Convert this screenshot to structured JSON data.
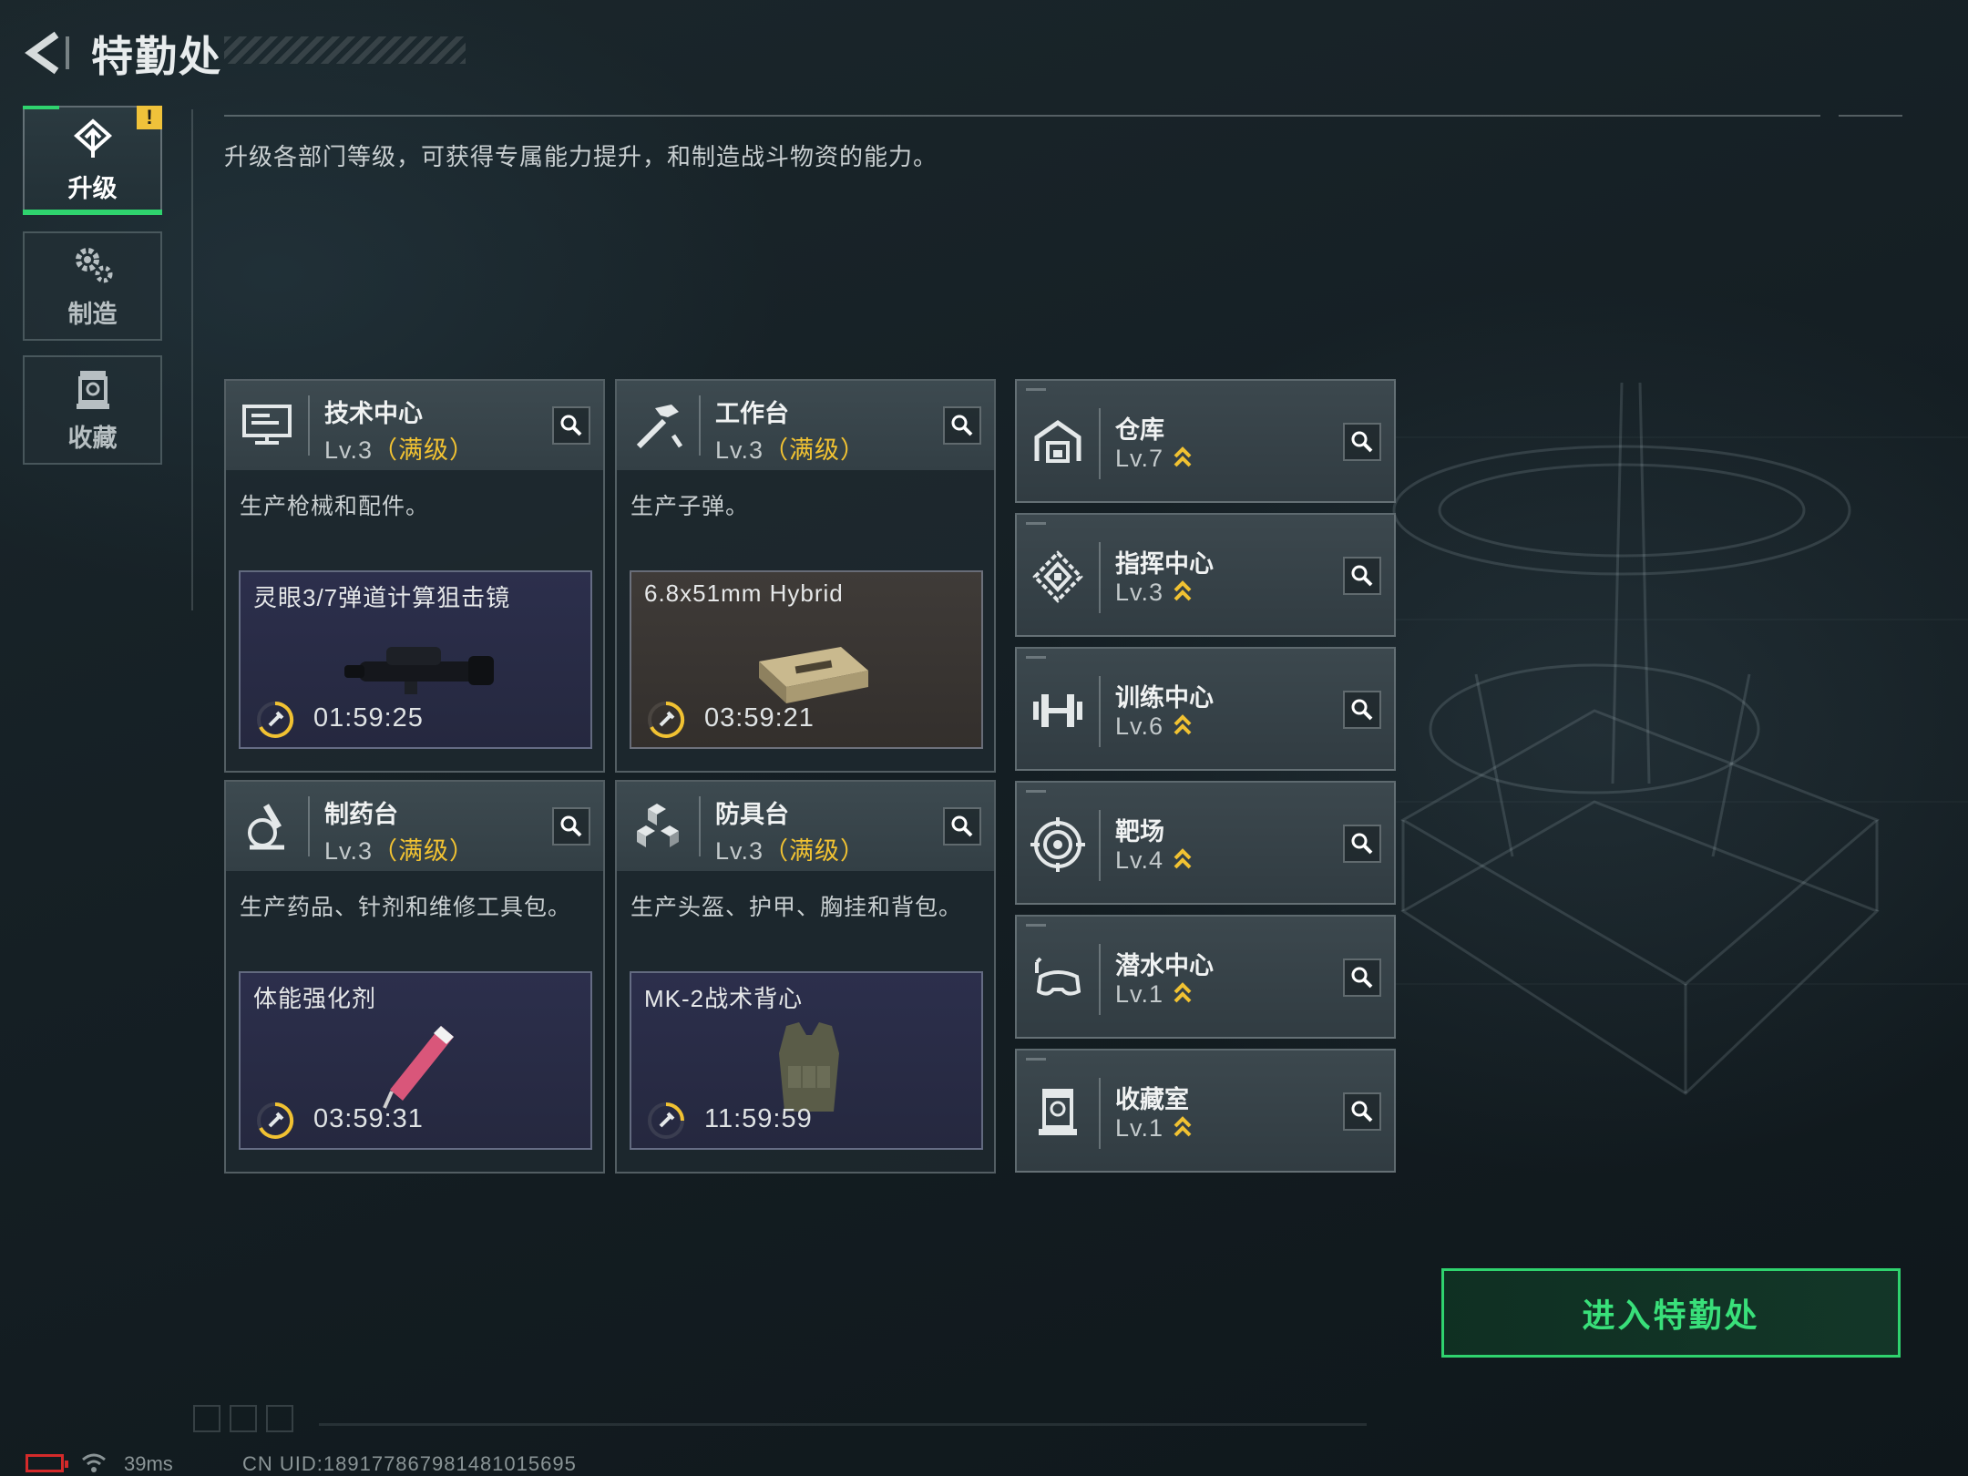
{
  "header": {
    "title": "特勤处",
    "subtitle": "升级各部门等级，可获得专属能力提升，和制造战斗物资的能力。"
  },
  "nav": {
    "tabs": [
      {
        "label": "升级",
        "icon": "upgrade-icon",
        "active": true,
        "badge": "!"
      },
      {
        "label": "制造",
        "icon": "gears-icon",
        "active": false
      },
      {
        "label": "收藏",
        "icon": "collection-icon",
        "active": false
      }
    ]
  },
  "departments": [
    {
      "name": "技术中心",
      "level": "Lv.3",
      "max": "（满级）",
      "desc": "生产枪械和配件。",
      "craft": {
        "item": "灵眼3/7弹道计算狙击镜",
        "timer": "01:59:25"
      }
    },
    {
      "name": "工作台",
      "level": "Lv.3",
      "max": "（满级）",
      "desc": "生产子弹。",
      "craft": {
        "item": "6.8x51mm Hybrid",
        "timer": "03:59:21"
      }
    },
    {
      "name": "制药台",
      "level": "Lv.3",
      "max": "（满级）",
      "desc": "生产药品、针剂和维修工具包。",
      "craft": {
        "item": "体能强化剂",
        "timer": "03:59:31"
      }
    },
    {
      "name": "防具台",
      "level": "Lv.3",
      "max": "（满级）",
      "desc": "生产头盔、护甲、胸挂和背包。",
      "craft": {
        "item": "MK-2战术背心",
        "timer": "11:59:59"
      }
    }
  ],
  "facilities": [
    {
      "name": "仓库",
      "level": "Lv.7",
      "icon": "warehouse-icon"
    },
    {
      "name": "指挥中心",
      "level": "Lv.3",
      "icon": "command-icon"
    },
    {
      "name": "训练中心",
      "level": "Lv.6",
      "icon": "dumbbell-icon"
    },
    {
      "name": "靶场",
      "level": "Lv.4",
      "icon": "target-icon"
    },
    {
      "name": "潜水中心",
      "level": "Lv.1",
      "icon": "diving-mask-icon"
    },
    {
      "name": "收藏室",
      "level": "Lv.1",
      "icon": "trophy-case-icon"
    }
  ],
  "actions": {
    "enter": "进入特勤处"
  },
  "footer": {
    "ping": "39ms",
    "uid": "CN UID:1891778679814810​15695"
  },
  "colors": {
    "accent": "#2fd36e",
    "max_level": "#f1c232",
    "upgrade_arrow": "#f1c232"
  }
}
